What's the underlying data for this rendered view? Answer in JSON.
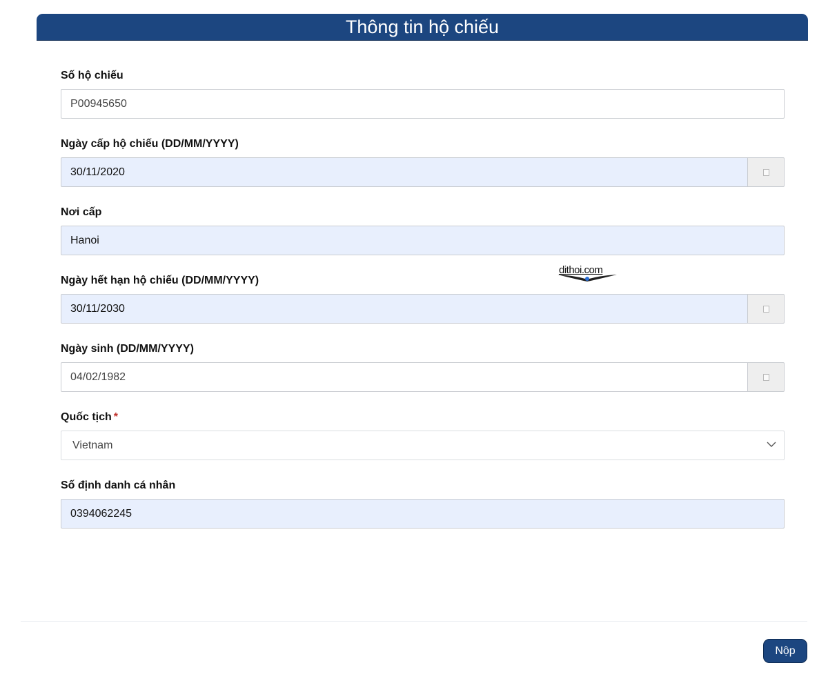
{
  "header": {
    "title": "Thông tin hộ chiếu"
  },
  "form": {
    "passport_number": {
      "label": "Số hộ chiếu",
      "value": "P00945650"
    },
    "issue_date": {
      "label": "Ngày cấp hộ chiếu (DD/MM/YYYY)",
      "value": "30/11/2020",
      "icon": "calendar-icon"
    },
    "place_of_issue": {
      "label": "Nơi cấp",
      "value": "Hanoi"
    },
    "expiry_date": {
      "label": "Ngày hết hạn hộ chiếu (DD/MM/YYYY)",
      "value": "30/11/2030",
      "icon": "calendar-icon"
    },
    "date_of_birth": {
      "label": "Ngày sinh (DD/MM/YYYY)",
      "value": "04/02/1982",
      "icon": "calendar-icon"
    },
    "nationality": {
      "label": "Quốc tịch",
      "required_mark": "*",
      "value": "Vietnam",
      "icon": "chevron-down-icon"
    },
    "personal_id": {
      "label": "Số định danh cá nhân",
      "value": "0394062245"
    }
  },
  "watermark": {
    "text": "dithoi.com"
  },
  "footer": {
    "submit_label": "Nộp"
  },
  "colors": {
    "header_bg": "#1c4680",
    "autofill_bg": "#e8effd",
    "required": "#c0302b",
    "addon_bg": "#eeeeee"
  }
}
